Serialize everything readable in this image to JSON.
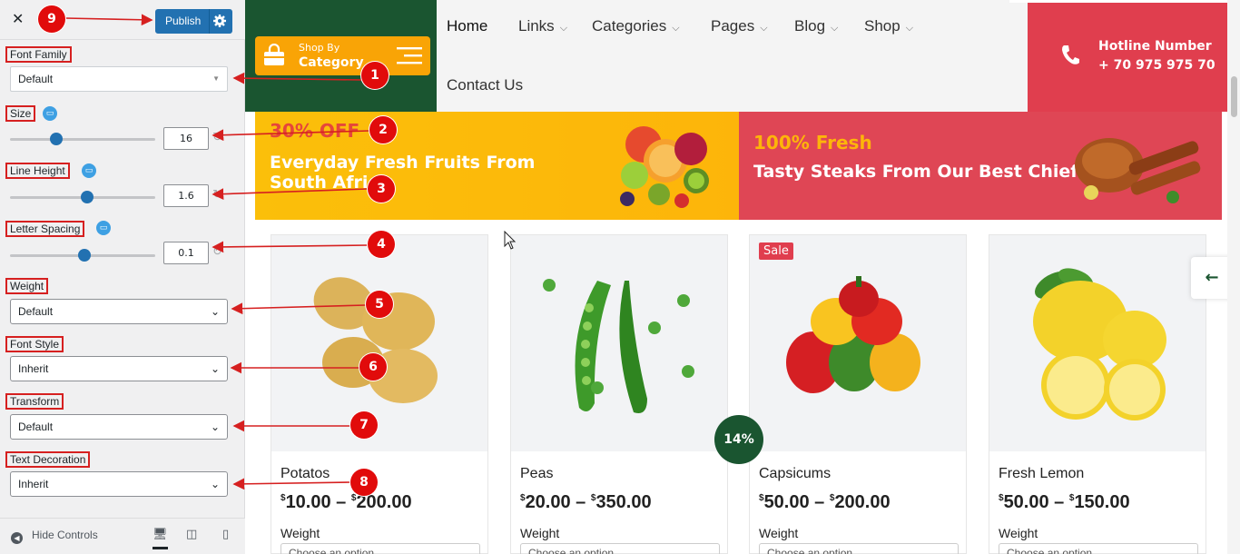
{
  "customizer": {
    "close_icon": "close-icon",
    "publish_label": "Publish",
    "font_family": {
      "label": "Font Family",
      "value": "Default"
    },
    "size": {
      "label": "Size",
      "value": "16",
      "slider_fraction": 0.32
    },
    "line_height": {
      "label": "Line Height",
      "value": "1.6",
      "slider_fraction": 0.53
    },
    "letter_spacing": {
      "label": "Letter Spacing",
      "value": "0.1",
      "slider_fraction": 0.51
    },
    "weight": {
      "label": "Weight",
      "value": "Default"
    },
    "font_style": {
      "label": "Font Style",
      "value": "Inherit"
    },
    "transform": {
      "label": "Transform",
      "value": "Default"
    },
    "text_decoration": {
      "label": "Text Decoration",
      "value": "Inherit"
    },
    "hide_controls": "Hide Controls",
    "accent_color": "#2271b1"
  },
  "annotations": [
    "9",
    "1",
    "2",
    "3",
    "4",
    "5",
    "6",
    "7",
    "8"
  ],
  "site": {
    "shop_by_line1": "Shop By",
    "shop_by_line2": "Category",
    "nav": [
      "Home",
      "Links",
      "Categories",
      "Pages",
      "Blog",
      "Shop"
    ],
    "nav_contact": "Contact Us",
    "hotline_title": "Hotline Number",
    "hotline_number": "+ 70 975 975 70",
    "banner1_offer": "30% OFF",
    "banner1_text": "Everyday Fresh Fruits From South Africa",
    "banner2_offer": "100% Fresh",
    "banner2_text": "Tasty Steaks From Our Best Chief",
    "discount_badge": "14%",
    "sale_label": "Sale",
    "products": [
      {
        "name": "Potatos",
        "cur1": "$",
        "min": "10.00",
        "cur2": "$",
        "max": "200.00",
        "weight_label": "Weight",
        "option": "Choose an option"
      },
      {
        "name": "Peas",
        "cur1": "$",
        "min": "20.00",
        "cur2": "$",
        "max": "350.00",
        "weight_label": "Weight",
        "option": "Choose an option"
      },
      {
        "name": "Capsicums",
        "cur1": "$",
        "min": "50.00",
        "cur2": "$",
        "max": "200.00",
        "weight_label": "Weight",
        "option": "Choose an option"
      },
      {
        "name": "Fresh Lemon",
        "cur1": "$",
        "min": "50.00",
        "cur2": "$",
        "max": "150.00",
        "weight_label": "Weight",
        "option": "Choose an option"
      }
    ],
    "colors": {
      "green": "#1a5530",
      "orange": "#f9a406",
      "red": "#e03e4e"
    }
  }
}
